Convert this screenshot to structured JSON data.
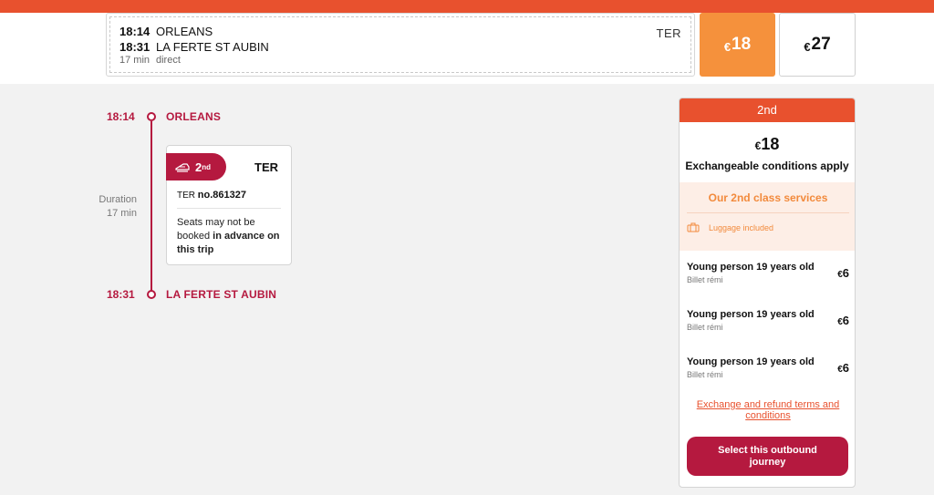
{
  "journey": {
    "departure_time": "18:14",
    "departure_station": "ORLEANS",
    "arrival_time": "18:31",
    "arrival_station": "LA FERTE ST AUBIN",
    "duration": "17 min",
    "connection": "direct",
    "train_type": "TER"
  },
  "prices": {
    "currency": "€",
    "second_class": "18",
    "first_class": "27"
  },
  "timeline": {
    "start_time": "18:14",
    "start_station": "ORLEANS",
    "end_time": "18:31",
    "end_station": "LA FERTE ST AUBIN",
    "duration_label": "Duration",
    "duration_value": "17 min"
  },
  "train_card": {
    "class_number": "2",
    "class_suffix": "nd",
    "train_type": "TER",
    "train_no_prefix": "TER",
    "train_no": "no.861327",
    "note_plain": "Seats may not be booked ",
    "note_bold": "in advance on this trip"
  },
  "fare_panel": {
    "class_label": "2nd",
    "currency": "€",
    "price": "18",
    "conditions": "Exchangeable conditions apply",
    "services_title": "Our 2nd class services",
    "luggage": "Luggage included",
    "passengers": [
      {
        "name": "Young person 19 years old",
        "fare": "Billet rémi",
        "currency": "€",
        "price": "6"
      },
      {
        "name": "Young person 19 years old",
        "fare": "Billet rémi",
        "currency": "€",
        "price": "6"
      },
      {
        "name": "Young person 19 years old",
        "fare": "Billet rémi",
        "currency": "€",
        "price": "6"
      }
    ],
    "terms_link": "Exchange and refund terms and conditions",
    "select_button": "Select this outbound journey"
  },
  "colors": {
    "brand_orange": "#e8512e",
    "price_orange": "#f5913c",
    "crimson": "#b5193f"
  }
}
